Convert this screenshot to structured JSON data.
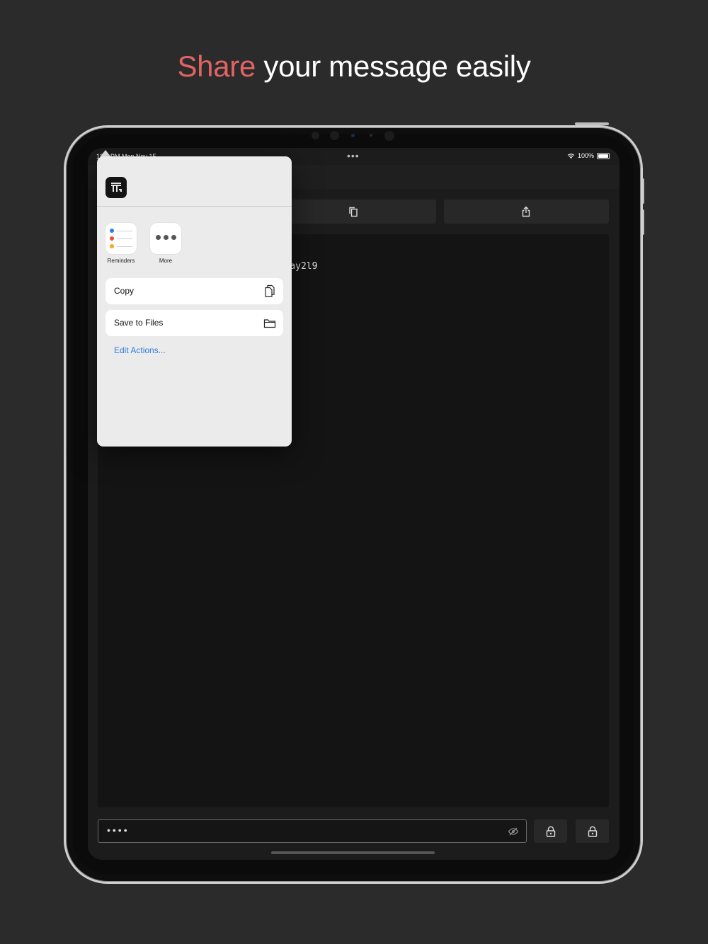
{
  "headline": {
    "accent": "Share",
    "rest": " your message easily"
  },
  "status_bar": {
    "time": "12:2 PM  Mon Nov 15",
    "battery": "100%"
  },
  "toolbar": {
    "buttons": [
      {
        "icon": "clipboard-icon"
      },
      {
        "icon": "copy-icon"
      },
      {
        "icon": "share-icon"
      }
    ]
  },
  "editor": {
    "ciphertext": "3mOjYJeTn92fmCCmWeVvSMkAzE+ay2l9"
  },
  "password": {
    "masked": "••••"
  },
  "share_sheet": {
    "apps": [
      {
        "label": "Reminders",
        "icon": "reminders-icon"
      },
      {
        "label": "More",
        "icon": "more-icon"
      }
    ],
    "actions": [
      {
        "label": "Copy",
        "icon": "copy-documents-icon"
      },
      {
        "label": "Save to Files",
        "icon": "folder-icon"
      }
    ],
    "edit_actions": "Edit Actions..."
  },
  "colors": {
    "accent": "#e06464",
    "link": "#2f7de0",
    "background": "#2b2b2b"
  }
}
